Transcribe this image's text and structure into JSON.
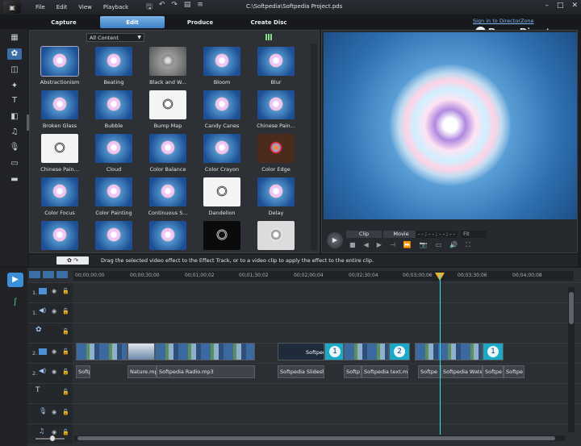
{
  "window": {
    "document_title": "C:\\Softpedia\\Softpedia Project.pds",
    "menu": [
      "File",
      "Edit",
      "View",
      "Playback"
    ]
  },
  "modes": [
    {
      "label": "Capture",
      "active": false
    },
    {
      "label": "Edit",
      "active": true
    },
    {
      "label": "Produce",
      "active": false
    },
    {
      "label": "Create Disc",
      "active": false
    }
  ],
  "account": {
    "signin_label": "Sign in to DirectorZone"
  },
  "brand": {
    "name": "PowerDirector"
  },
  "library": {
    "filter_value": "All Content",
    "effects": [
      "Abstractionism",
      "Beating",
      "Black and W...",
      "Bloom",
      "Blur",
      "Broken Glass",
      "Bubble",
      "Bump Map",
      "Candy Canes",
      "Chinese Pain...",
      "Chinese Pain...",
      "Cloud",
      "Color Balance",
      "Color Crayon",
      "Color Edge",
      "Color Focus",
      "Color Painting",
      "Continuous S...",
      "Dandelion",
      "Delay",
      "",
      "",
      "",
      "",
      ""
    ]
  },
  "preview": {
    "mode_clip": "Clip",
    "mode_movie": "Movie",
    "timecode": "- - ; - - ; - - ; - -",
    "fit": "Fit"
  },
  "hint": {
    "text": "Drag the selected video effect to the Effect Track, or to a video clip to apply the effect to the entire clip."
  },
  "timeline": {
    "ruler": [
      "00;00;00;00",
      "00;00;30;00",
      "00;01;00;02",
      "00;01;30;02",
      "00;02;00;04",
      "00;02;30;04",
      "00;03;00;06",
      "00;03;30;06",
      "00;04;00;08"
    ],
    "tracks": {
      "video1": "1.",
      "audio1": "1.",
      "video2": "2.",
      "audio2": "2."
    },
    "video_clips": [
      {
        "label": ""
      },
      {
        "label": ""
      },
      {
        "label": ""
      },
      {
        "label": "Softpedia"
      },
      {
        "label": ""
      },
      {
        "label": ""
      },
      {
        "label": ""
      },
      {
        "label": ""
      },
      {
        "label": ""
      }
    ],
    "audio_clips": [
      "Softp",
      "Nature.mp3",
      "Softpedia Radio.mp3",
      "Softpedia Slidesh",
      "Softp",
      "Softpedia text.mp3",
      "Softpe",
      "Softpedia Water",
      "Softpe",
      "Softpe"
    ]
  }
}
